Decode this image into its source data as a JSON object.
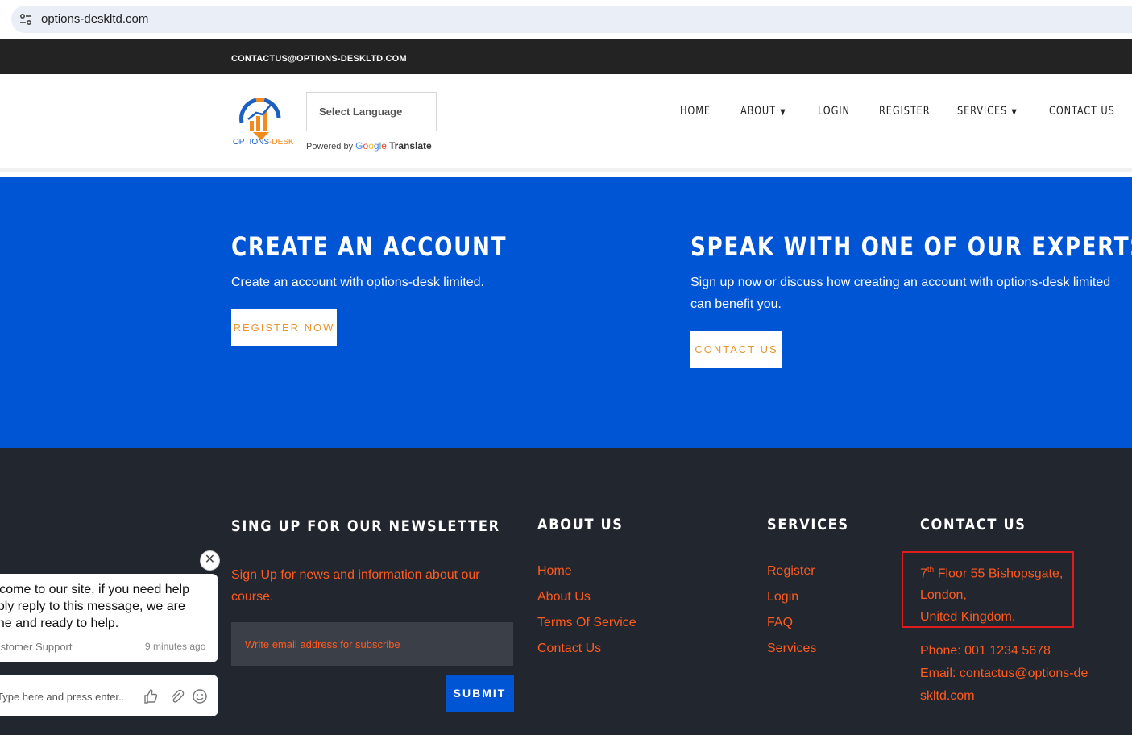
{
  "browser": {
    "url": "options-deskltd.com"
  },
  "topbar": {
    "email": "CONTACTUS@OPTIONS-DESKLTD.COM"
  },
  "header": {
    "logo_text_part1": "OPTIONS",
    "logo_text_part2": "-DESK",
    "language_select": "Select Language",
    "powered_by": "Powered by",
    "google": [
      "G",
      "o",
      "o",
      "g",
      "l",
      "e"
    ],
    "translate": "Translate",
    "nav": [
      {
        "label": "HOME"
      },
      {
        "label": "ABOUT"
      },
      {
        "label": "LOGIN"
      },
      {
        "label": "REGISTER"
      },
      {
        "label": "SERVICES"
      },
      {
        "label": "CONTACT US"
      }
    ]
  },
  "cta": {
    "left": {
      "title": "CREATE AN ACCOUNT",
      "text": "Create an account with options-desk limited.",
      "button": "REGISTER NOW"
    },
    "right": {
      "title": "SPEAK WITH ONE OF OUR EXPERTS",
      "text_line1": "Sign up now or discuss how creating an account with options-desk limited",
      "text_line2": "can benefit you.",
      "button": "CONTACT US"
    }
  },
  "footer": {
    "newsletter": {
      "title": "SING UP FOR OUR NEWSLETTER",
      "text": "Sign Up for news and information about our course.",
      "placeholder": "Write email address for subscribe",
      "submit": "SUBMIT"
    },
    "about": {
      "title": "ABOUT US",
      "links": [
        "Home",
        "About Us",
        "Terms Of Service",
        "Contact Us"
      ]
    },
    "services": {
      "title": "SERVICES",
      "links": [
        "Register",
        "Login",
        "FAQ",
        "Services"
      ]
    },
    "contact": {
      "title": "CONTACT US",
      "address_floor": "7",
      "address_sup": "th",
      "address_line1_rest": " Floor 55 Bishopsgate,",
      "address_line2": "London,",
      "address_line3": "United Kingdom.",
      "phone": "Phone: 001 1234 5678",
      "email": "Email: contactus@options-deskltd.com"
    }
  },
  "chat": {
    "close": "✕",
    "message": "Welcome to our site, if you need help simply reply to this message, we are online and ready to help.",
    "agent": "Customer Support",
    "time": "9 minutes ago",
    "input_placeholder": "Type here and press enter.."
  },
  "colors": {
    "brand_blue": "#0055d4",
    "accent_orange": "#ff5a1f",
    "button_text_orange": "#e8942e",
    "dark_bg": "#22262e"
  }
}
